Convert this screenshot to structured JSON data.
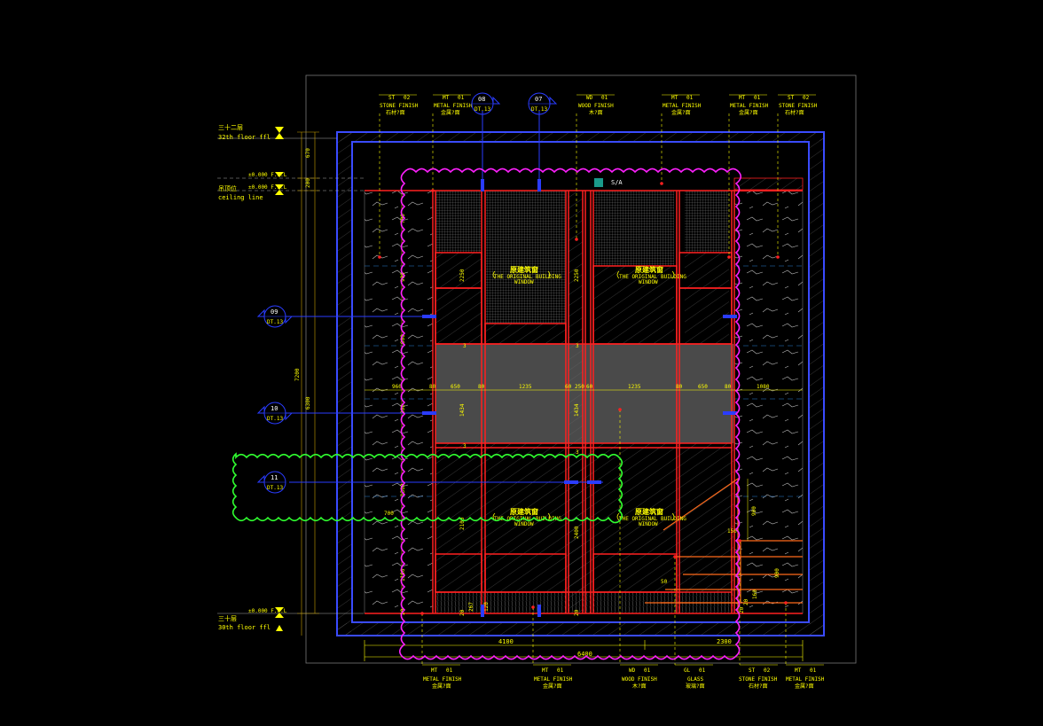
{
  "levels": {
    "floor32_cn": "三十二层",
    "floor32_en": "32th floor ffl",
    "ffl_a": "±0.000 F.F.L",
    "ffl_b": "±0.000 F.F.L",
    "ceiling_cn": "吊顶位",
    "ceiling_en": "ceiling line",
    "floor30_cn": "三十层",
    "floor30_en": "30th floor ffl",
    "ffl_c": "±0.000 F.F.L"
  },
  "top_tags": [
    {
      "code": "ST",
      "num": "02",
      "en": "STONE FINISH",
      "cn": "石材?面"
    },
    {
      "code": "MT",
      "num": "01",
      "en": "METAL FINISH",
      "cn": "金属?面"
    },
    {
      "code": "WD",
      "num": "01",
      "en": "WOOD FINISH",
      "cn": "木?面"
    },
    {
      "code": "MT",
      "num": "01",
      "en": "METAL FINISH",
      "cn": "金属?面"
    },
    {
      "code": "MT",
      "num": "01",
      "en": "METAL FINISH",
      "cn": "金属?面"
    },
    {
      "code": "ST",
      "num": "02",
      "en": "STONE FINISH",
      "cn": "石材?面"
    }
  ],
  "bottom_tags": [
    {
      "code": "MT",
      "num": "01",
      "en": "METAL FINISH",
      "cn": "金属?面"
    },
    {
      "code": "MT",
      "num": "01",
      "en": "METAL FINISH",
      "cn": "金属?面"
    },
    {
      "code": "WD",
      "num": "01",
      "en": "WOOD FINISH",
      "cn": "木?面"
    },
    {
      "code": "GL",
      "num": "01",
      "en": "GLASS",
      "cn": "玻璃?面"
    },
    {
      "code": "ST",
      "num": "02",
      "en": "STONE FINISH",
      "cn": "石材?面"
    },
    {
      "code": "MT",
      "num": "01",
      "en": "METAL FINISH",
      "cn": "金属?面"
    }
  ],
  "section_markers": [
    {
      "num": "08",
      "ref": "DT.13"
    },
    {
      "num": "07",
      "ref": "DT.13"
    },
    {
      "num": "09",
      "ref": "DT.13"
    },
    {
      "num": "10",
      "ref": "DT.13"
    },
    {
      "num": "11",
      "ref": "DT.13"
    }
  ],
  "window_labels": [
    {
      "cn": "原建筑窗",
      "en": "THE ORIGINAL BUILDING",
      "en2": "WINDOW"
    },
    {
      "cn": "原建筑窗",
      "en": "THE ORIGINAL BUILDING",
      "en2": "WINDOW"
    },
    {
      "cn": "原建筑窗",
      "en": "THE ORIGINAL BUILDING",
      "en2": "WINDOW"
    },
    {
      "cn": "原建筑窗",
      "en": "THE ORIGINAL BUILDING",
      "en2": "WINDOW"
    }
  ],
  "sa_label": "S/A",
  "horizontal_dims": [
    "960",
    "80",
    "650",
    "80",
    "1235",
    "60",
    "250",
    "60",
    "1235",
    "80",
    "650",
    "80",
    "1080"
  ],
  "left_dims": {
    "d670": "670",
    "d200": "200",
    "d7200": "7200",
    "d6300": "6300",
    "d700": "700",
    "d900a": "900",
    "d900b": "900",
    "d900c": "900",
    "d1300": "1300",
    "d1100": "1100",
    "d20": "20"
  },
  "inner_dims": {
    "d2250a": "2250",
    "d2250b": "2250",
    "d1434a": "1434",
    "d1434b": "1434",
    "d2100": "2100",
    "d2400": "2400",
    "d20a": "20",
    "d20b": "20",
    "d20c": "20",
    "d267": "267",
    "d120": "120",
    "d700b": "700",
    "d3a": "3",
    "d3b": "3",
    "d3c": "3",
    "d3d": "3"
  },
  "stair_dims": {
    "d900": "900",
    "d150": "150",
    "d50": "50",
    "d900b": "900",
    "d160": "160",
    "d20": "20"
  },
  "bottom_dims": {
    "d4100": "4100",
    "d2300": "2300",
    "d6400": "6400"
  }
}
